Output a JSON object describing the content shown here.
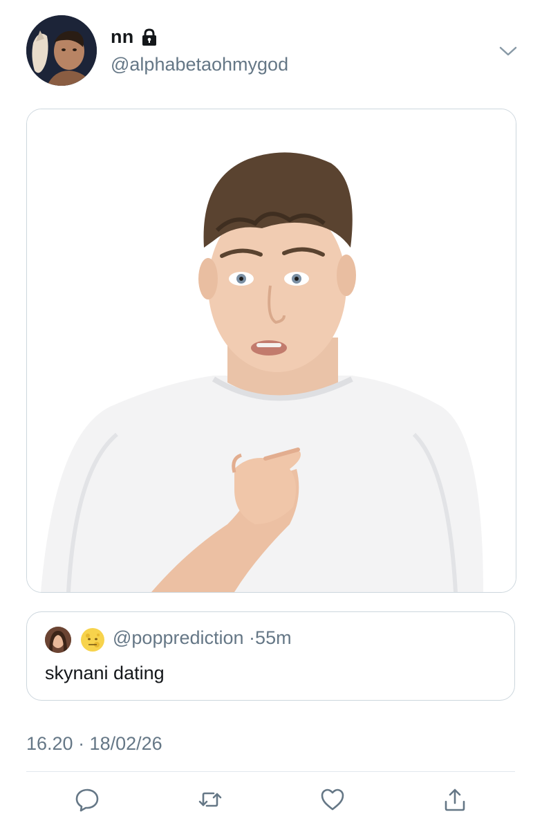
{
  "tweet": {
    "display_name": "nn",
    "handle": "@alphabetaohmygod",
    "timestamp": "16.20 · 18/02/26"
  },
  "quoted_tweet": {
    "handle": "@popprediction",
    "separator": "·",
    "age": "55m",
    "text": "skynani dating"
  },
  "icons": {
    "lock": "lock-icon",
    "chevron": "chevron-down-icon",
    "reply": "reply-icon",
    "retweet": "retweet-icon",
    "like": "heart-icon",
    "share": "share-icon",
    "moon": "moon-emoji-icon"
  },
  "colors": {
    "text": "#14171a",
    "secondary": "#657786",
    "border": "#ccd6dd",
    "divider": "#e1e8ed"
  }
}
